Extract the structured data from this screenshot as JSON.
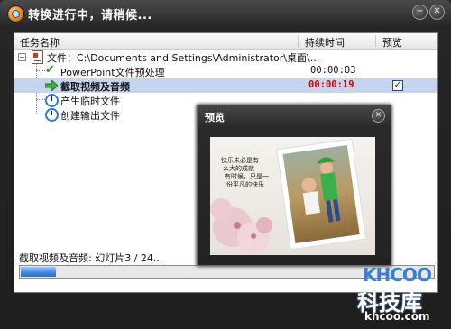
{
  "window": {
    "title": "转换进行中，请稍候...",
    "minimize_glyph": "−",
    "close_glyph": "✕"
  },
  "table": {
    "columns": [
      "任务名称",
      "持续时间",
      "预览"
    ],
    "rows": [
      {
        "label": "文件：C:\\Documents and Settings\\Administrator\\桌面\\...",
        "time": "",
        "icon": "file-icon",
        "preview": false
      },
      {
        "label": "PowerPoint文件预处理",
        "time": "00:00:03",
        "icon": "check-icon",
        "preview": false
      },
      {
        "label": "截取视频及音频",
        "time": "00:00:19",
        "icon": "arrow-icon",
        "preview": true,
        "selected": true
      },
      {
        "label": "产生临时文件",
        "time": "",
        "icon": "clock-icon",
        "preview": false
      },
      {
        "label": "创建输出文件",
        "time": "",
        "icon": "clock-icon",
        "preview": false
      }
    ]
  },
  "status": {
    "text": "截取视频及音频: 幻灯片3 / 24...",
    "progress": 0.085
  },
  "preview_window": {
    "title": "预览",
    "close_glyph": "✕",
    "slide_text": [
      "快乐未必是有",
      "么大的成就",
      "有时候，只是一",
      "份平凡的快乐"
    ]
  },
  "watermark": {
    "logo": "KHCOO",
    "name": "科技库",
    "domain": "khcoo.com"
  },
  "colors": {
    "accent": "#3f86e0",
    "selected_row": "#c6d4ee",
    "running_time": "#d00000",
    "done_check": "#1f9a1f"
  }
}
